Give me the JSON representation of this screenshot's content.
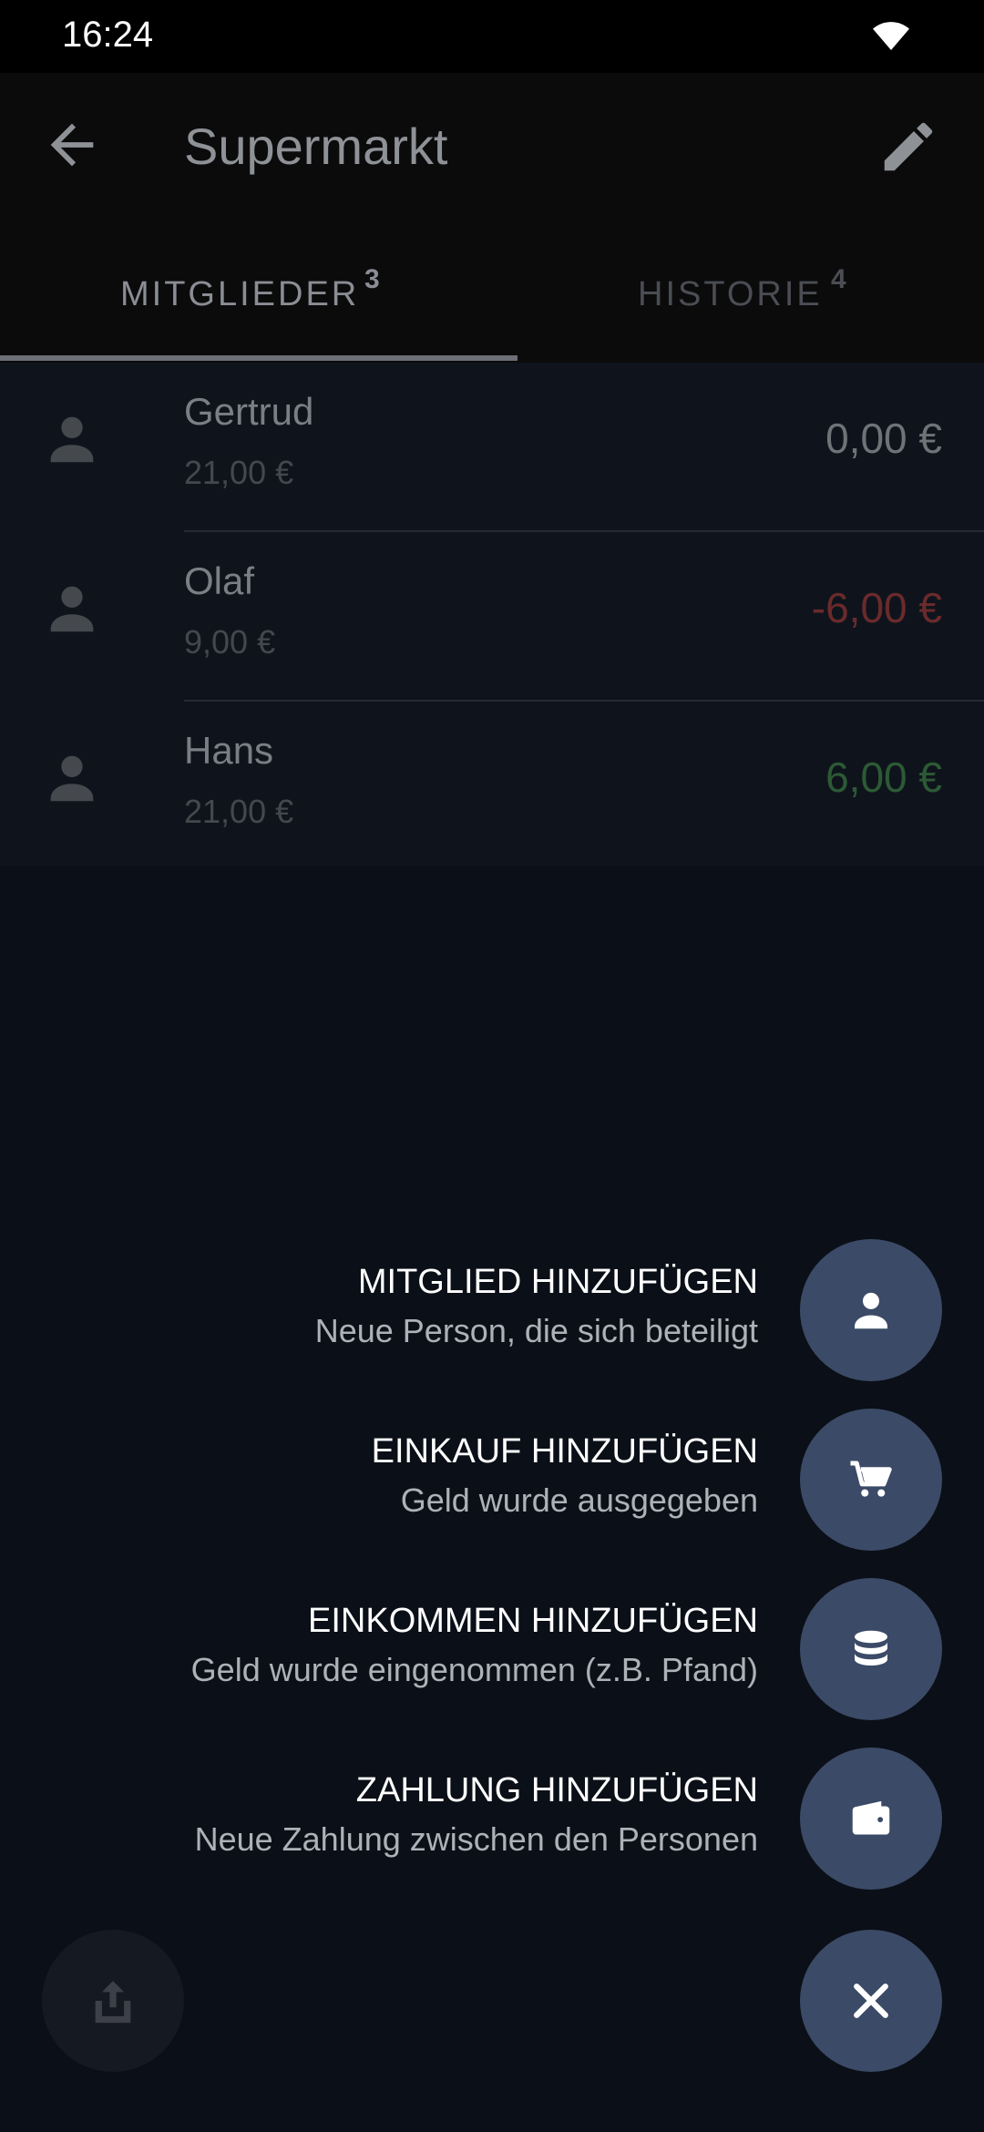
{
  "status_bar": {
    "time": "16:24"
  },
  "app_bar": {
    "title": "Supermarkt"
  },
  "tabs": [
    {
      "label": "MITGLIEDER",
      "count": "3",
      "active": true
    },
    {
      "label": "HISTORIE",
      "count": "4",
      "active": false
    }
  ],
  "members": [
    {
      "name": "Gertrud",
      "spent": "21,00 €",
      "balance": "0,00 €",
      "balance_color": "#6f7277"
    },
    {
      "name": "Olaf",
      "spent": "9,00 €",
      "balance": "-6,00 €",
      "balance_color": "#6b2a2c"
    },
    {
      "name": "Hans",
      "spent": "21,00 €",
      "balance": "6,00 €",
      "balance_color": "#2c5a35"
    }
  ],
  "speed_dial": [
    {
      "title": "MITGLIED HINZUFÜGEN",
      "subtitle": "Neue Person, die sich beteiligt",
      "icon": "person-icon"
    },
    {
      "title": "EINKAUF HINZUFÜGEN",
      "subtitle": "Geld wurde ausgegeben",
      "icon": "cart-icon"
    },
    {
      "title": "EINKOMMEN HINZUFÜGEN",
      "subtitle": "Geld wurde eingenommen (z.B. Pfand)",
      "icon": "coins-icon"
    },
    {
      "title": "ZAHLUNG HINZUFÜGEN",
      "subtitle": "Neue Zahlung zwischen den Personen",
      "icon": "wallet-icon"
    }
  ],
  "colors": {
    "fab": "#3b4a66",
    "background": "#0b0f17"
  }
}
